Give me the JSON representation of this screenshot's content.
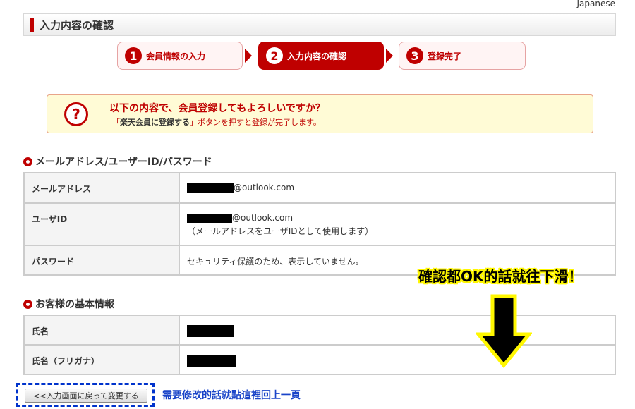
{
  "header": {
    "language": "Japanese",
    "page_title": "入力内容の確認"
  },
  "steps": [
    {
      "num": "1",
      "label": "会員情報の入力",
      "state": "done"
    },
    {
      "num": "2",
      "label": "入力内容の確認",
      "state": "current"
    },
    {
      "num": "3",
      "label": "登録完了",
      "state": "todo"
    }
  ],
  "confirm": {
    "icon": "question-icon",
    "title": "以下の内容で、会員登録してもよろしいですか？",
    "desc_prefix": "「",
    "desc_button": "楽天会員に登録する",
    "desc_suffix": "」ボタンを押すと登録が完了します。"
  },
  "account_section": {
    "title": "メールアドレス/ユーザーID/パスワード",
    "rows": [
      {
        "label": "メールアドレス",
        "value": "@outlook.com"
      },
      {
        "label": "ユーザID",
        "value": "@outlook.com",
        "sub": "（メールアドレスをユーザIDとして使用します）"
      },
      {
        "label": "パスワード",
        "value": "セキュリティ保護のため、表示していません。"
      }
    ]
  },
  "basic_section": {
    "title": "お客様の基本情報",
    "rows": [
      {
        "label": "氏名",
        "value": ""
      },
      {
        "label": "氏名（フリガナ）",
        "value": ""
      }
    ]
  },
  "annotations": {
    "scroll_hint": "確認都OK的話就往下滑！",
    "back_hint": "需要修改的話就點這裡回上一頁"
  },
  "actions": {
    "back_label": "<<入力画面に戻って変更する"
  },
  "colors": {
    "brand_red": "#bf0000",
    "notice_bg": "#fffbd6",
    "annotation_yellow": "#fff700",
    "annotation_blue": "#1a44c8"
  }
}
